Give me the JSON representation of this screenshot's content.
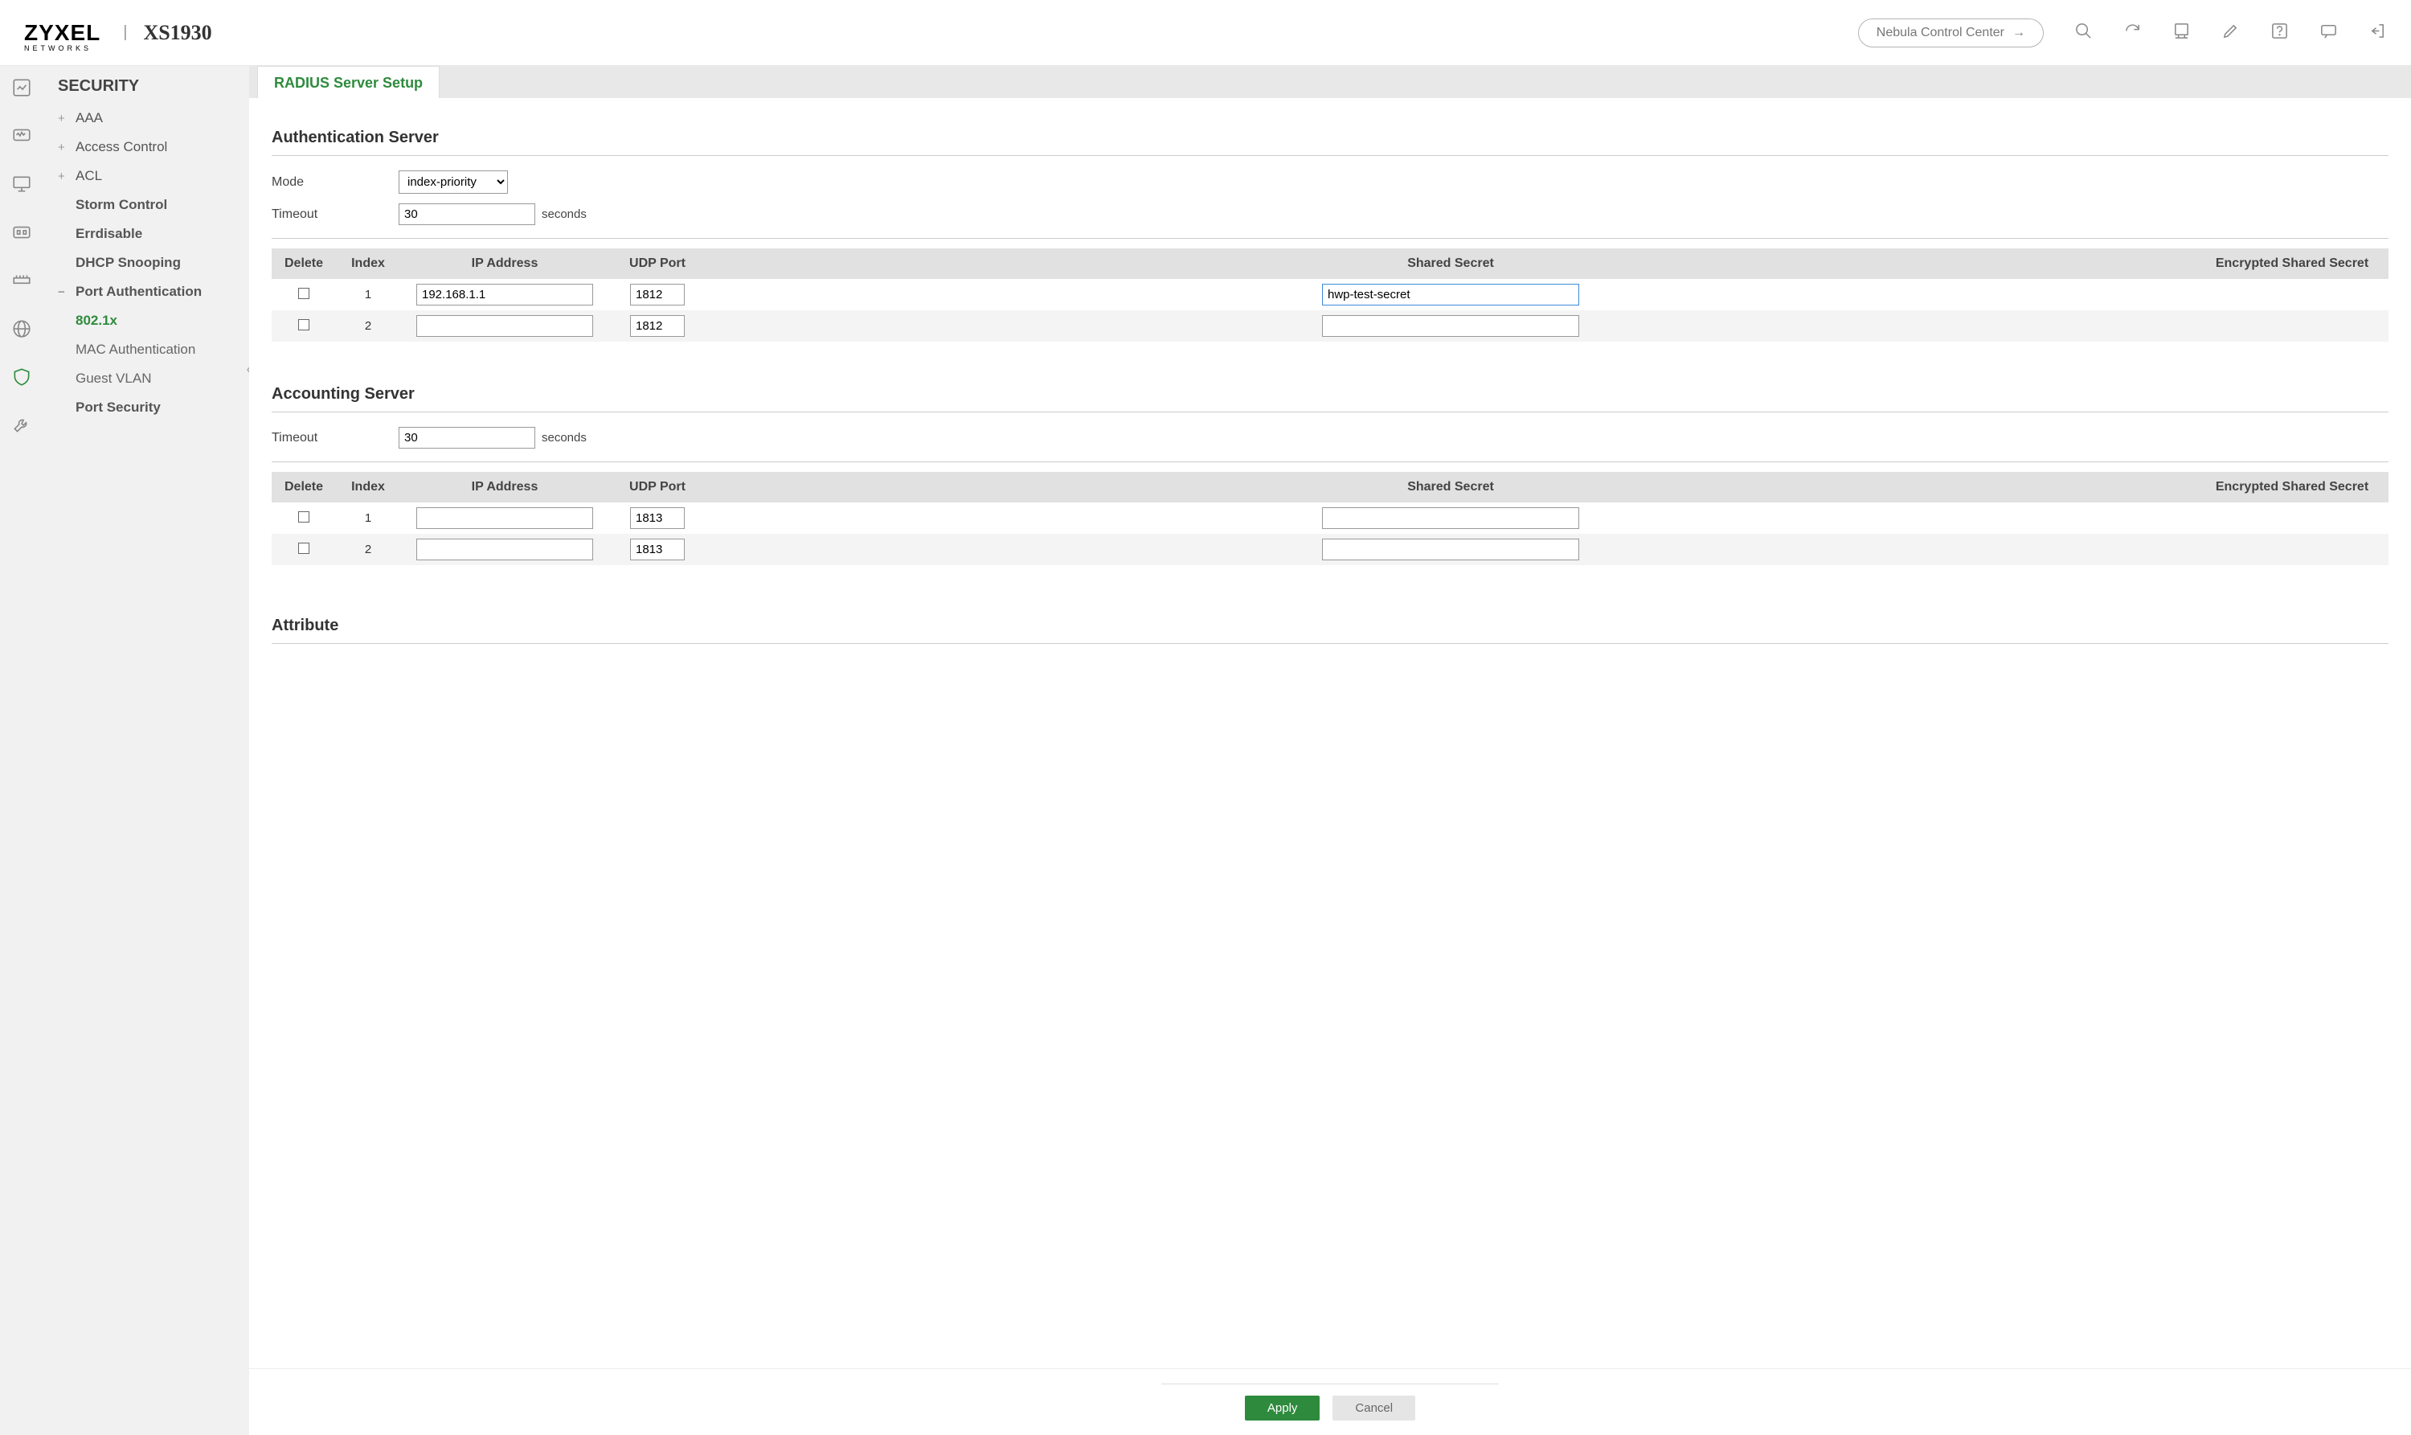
{
  "header": {
    "brand": "ZYXEL",
    "brand_sub": "NETWORKS",
    "product": "XS1930",
    "ncc": "Nebula Control Center"
  },
  "sidebar": {
    "title": "SECURITY",
    "items": [
      {
        "label": "AAA",
        "type": "expandable"
      },
      {
        "label": "Access Control",
        "type": "expandable"
      },
      {
        "label": "ACL",
        "type": "expandable"
      },
      {
        "label": "Storm Control",
        "type": "leaf bold"
      },
      {
        "label": "Errdisable",
        "type": "leaf bold"
      },
      {
        "label": "DHCP Snooping",
        "type": "leaf bold"
      },
      {
        "label": "Port Authentication",
        "type": "expanded bold"
      },
      {
        "label": "802.1x",
        "type": "leaf active"
      },
      {
        "label": "MAC Authentication",
        "type": "leaf"
      },
      {
        "label": "Guest VLAN",
        "type": "leaf"
      },
      {
        "label": "Port Security",
        "type": "leaf bold"
      }
    ]
  },
  "tab": "RADIUS Server Setup",
  "auth_section": {
    "title": "Authentication Server",
    "mode_label": "Mode",
    "mode_value": "index-priority",
    "timeout_label": "Timeout",
    "timeout_value": "30",
    "timeout_unit": "seconds",
    "columns": {
      "del": "Delete",
      "idx": "Index",
      "ip": "IP Address",
      "port": "UDP Port",
      "secret": "Shared Secret",
      "enc": "Encrypted Shared Secret"
    },
    "rows": [
      {
        "index": "1",
        "ip": "192.168.1.1",
        "port": "1812",
        "secret": "hwp-test-secret",
        "focused": true
      },
      {
        "index": "2",
        "ip": "",
        "port": "1812",
        "secret": ""
      }
    ]
  },
  "acct_section": {
    "title": "Accounting Server",
    "timeout_label": "Timeout",
    "timeout_value": "30",
    "timeout_unit": "seconds",
    "columns": {
      "del": "Delete",
      "idx": "Index",
      "ip": "IP Address",
      "port": "UDP Port",
      "secret": "Shared Secret",
      "enc": "Encrypted Shared Secret"
    },
    "rows": [
      {
        "index": "1",
        "ip": "",
        "port": "1813",
        "secret": ""
      },
      {
        "index": "2",
        "ip": "",
        "port": "1813",
        "secret": ""
      }
    ]
  },
  "attr_section": {
    "title": "Attribute"
  },
  "footer": {
    "apply": "Apply",
    "cancel": "Cancel"
  }
}
